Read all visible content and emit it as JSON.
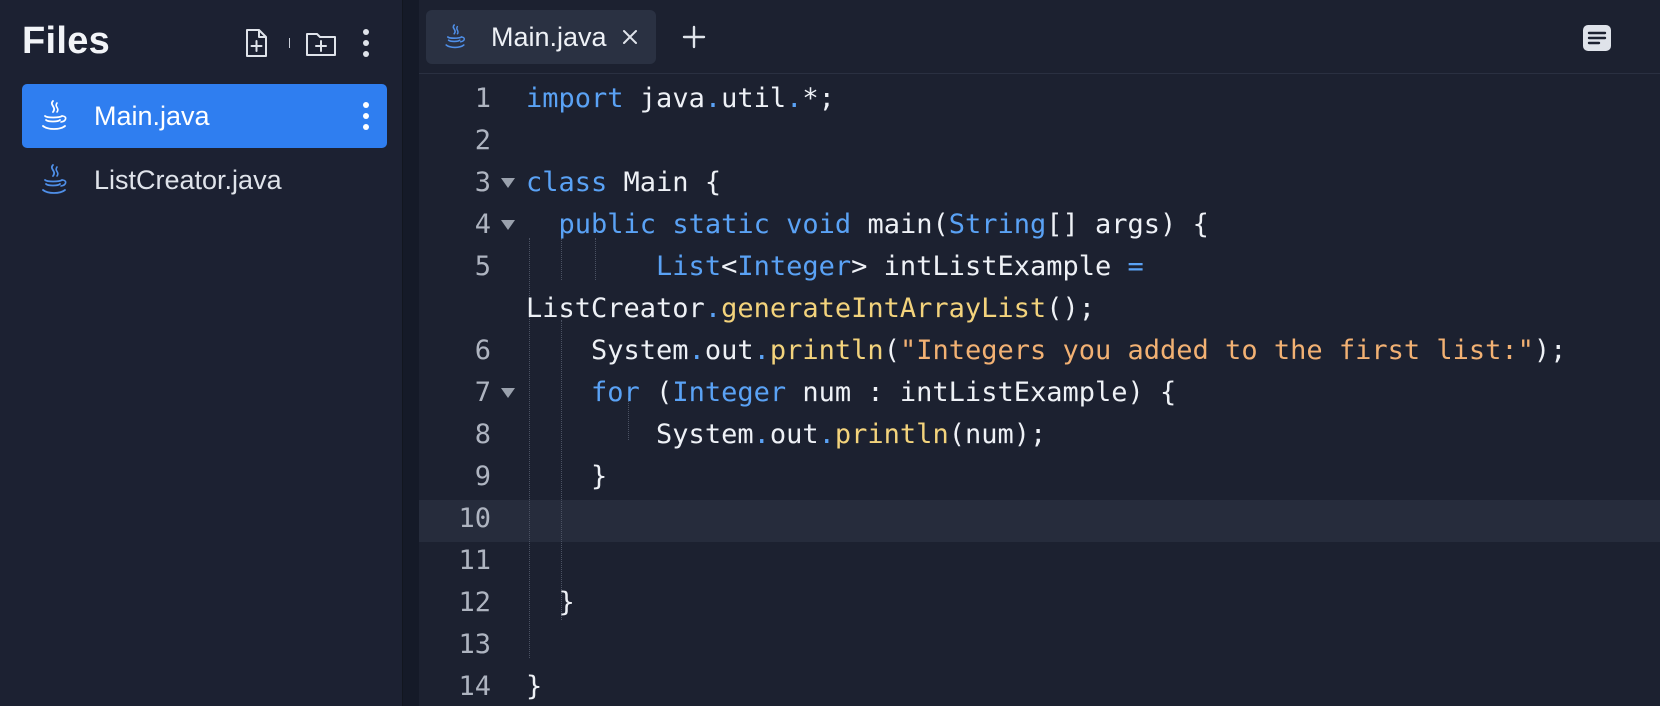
{
  "sidebar": {
    "title": "Files",
    "files": [
      {
        "label": "Main.java",
        "active": true
      },
      {
        "label": "ListCreator.java",
        "active": false
      }
    ]
  },
  "editor": {
    "tab": {
      "label": "Main.java"
    },
    "active_line": 10,
    "lines": [
      {
        "n": "1"
      },
      {
        "n": "2"
      },
      {
        "n": "3"
      },
      {
        "n": "4"
      },
      {
        "n": "5"
      },
      {
        "n": "6"
      },
      {
        "n": "7"
      },
      {
        "n": "8"
      },
      {
        "n": "9"
      },
      {
        "n": "10"
      },
      {
        "n": "11"
      },
      {
        "n": "12"
      },
      {
        "n": "13"
      },
      {
        "n": "14"
      }
    ],
    "code": {
      "l1": {
        "kw": "import",
        "rest": " java",
        "dot": ".",
        "rest2": "util",
        "dot2": ".",
        "rest3": "*;"
      },
      "l3": {
        "kw": "class",
        "rest": " Main {"
      },
      "l4": {
        "kw1": "public",
        "kw2": "static",
        "kw3": "void",
        "name": "main(",
        "typ": "String",
        "rest": "[] args) {"
      },
      "l5a": {
        "typ1": "List",
        "lt": "<",
        "typ2": "Integer",
        "gt": ">",
        "rest": " intListExample ",
        "eq": "="
      },
      "l5b": {
        "cls": "ListCreator",
        "dot": ".",
        "fn": "generateIntArrayList",
        "rest": "();"
      },
      "l6": {
        "obj": "System",
        "dot1": ".",
        "field": "out",
        "dot2": ".",
        "fn": "println",
        "open": "(",
        "str": "\"Integers you added to the first list:\"",
        "close": ");"
      },
      "l7": {
        "kw": "for",
        "open": " (",
        "typ": "Integer",
        "rest": " num : intListExample) {"
      },
      "l8": {
        "obj": "System",
        "dot1": ".",
        "field": "out",
        "dot2": ".",
        "fn": "println",
        "rest": "(num);"
      },
      "l9": {
        "text": "}"
      },
      "l12": {
        "text": "}"
      },
      "l14": {
        "text": "}"
      }
    }
  },
  "colors": {
    "accent": "#2f7ef0",
    "keyword": "#5aa2f5",
    "function": "#f3d37c",
    "string": "#f2b173",
    "background": "#1c2130"
  },
  "icons": [
    "new-file-icon",
    "new-folder-icon",
    "more-vertical-icon",
    "java-icon",
    "close-icon",
    "plus-icon",
    "outline-icon",
    "fold-arrow-icon"
  ]
}
